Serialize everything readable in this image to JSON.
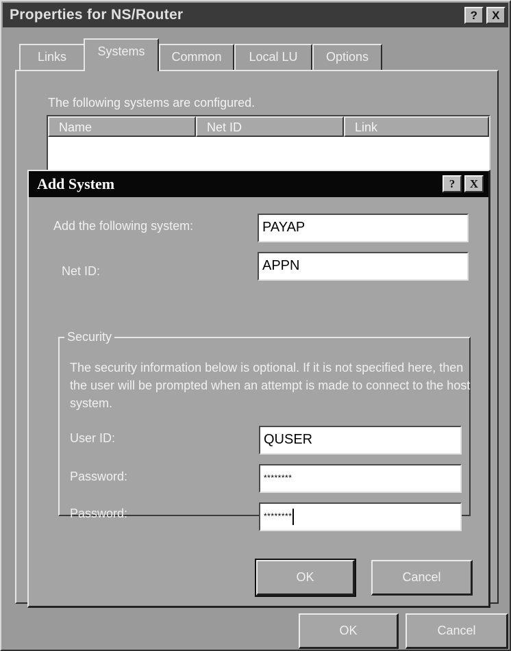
{
  "outer_window": {
    "title": "Properties for NS/Router",
    "help_button": "?",
    "close_button": "X",
    "tabs": [
      {
        "label": "Links"
      },
      {
        "label": "Systems",
        "active": true
      },
      {
        "label": "Common"
      },
      {
        "label": "Local LU"
      },
      {
        "label": "Options"
      }
    ],
    "systems_tab": {
      "configured_label": "The following systems are configured.",
      "columns": [
        "Name",
        "Net ID",
        "Link"
      ],
      "rows": []
    },
    "ok_button": "OK",
    "cancel_button": "Cancel"
  },
  "add_system_dialog": {
    "title": "Add System",
    "help_button": "?",
    "close_button": "X",
    "system_label": "Add the following system:",
    "system_value": "PAYAP",
    "netid_label": "Net ID:",
    "netid_value": "APPN",
    "security": {
      "legend": "Security",
      "description": "The security information below is optional. If it is not specified here, then the user will be prompted when an attempt is made to connect to the host system.",
      "userid_label": "User ID:",
      "userid_value": "QUSER",
      "password_label": "Password:",
      "password_value": "********",
      "password_confirm_label": "Password:",
      "password_confirm_value": "********"
    },
    "ok_button": "OK",
    "cancel_button": "Cancel"
  }
}
